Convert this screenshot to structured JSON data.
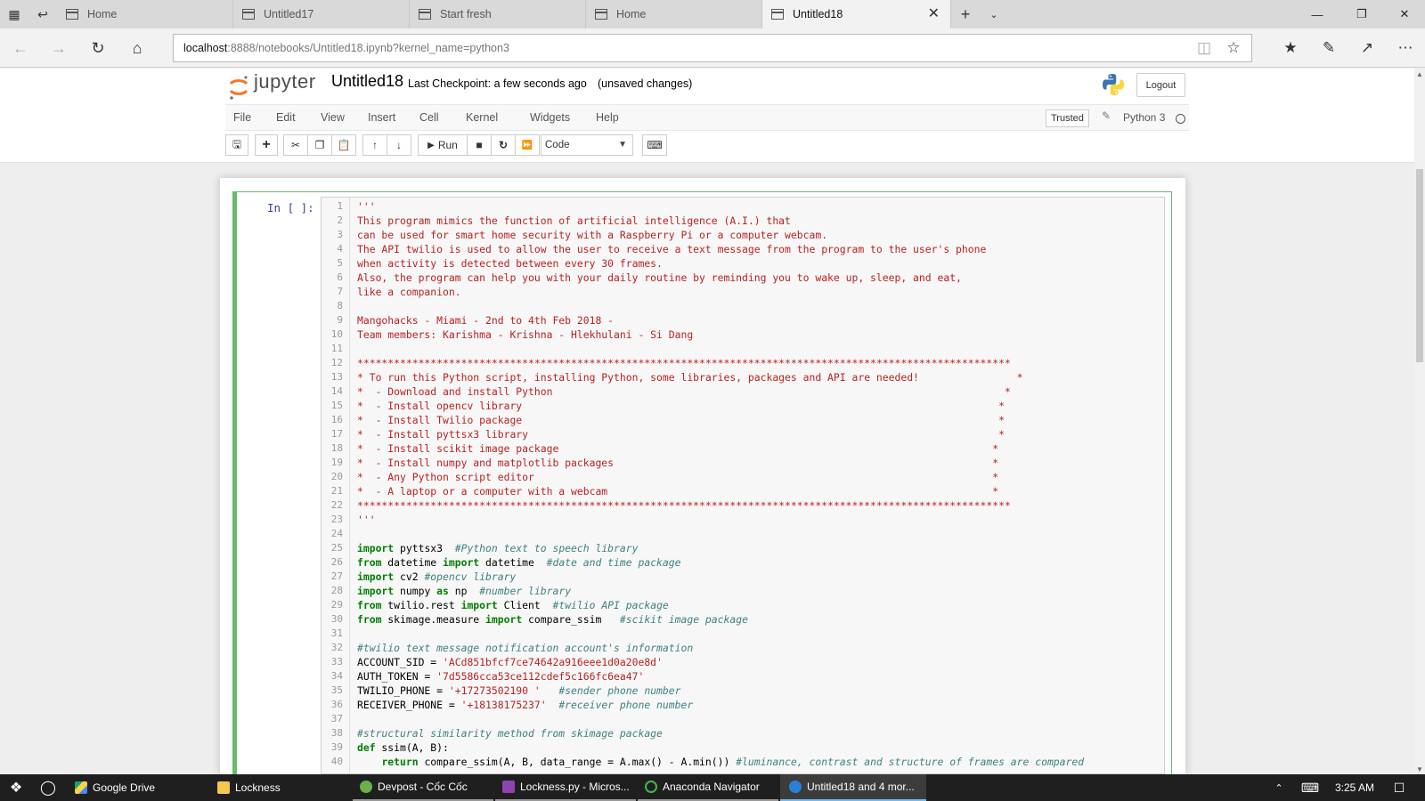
{
  "browser": {
    "tabs": [
      {
        "label": "Home"
      },
      {
        "label": "Untitled17"
      },
      {
        "label": "Start fresh"
      },
      {
        "label": "Home"
      },
      {
        "label": "Untitled18"
      }
    ],
    "url_host": "localhost",
    "url_rest": ":8888/notebooks/Untitled18.ipynb?kernel_name=python3"
  },
  "jupyter": {
    "logo_text": "jupyter",
    "notebook_name": "Untitled18",
    "checkpoint": "Last Checkpoint: a few seconds ago",
    "unsaved": "(unsaved changes)",
    "logout_label": "Logout",
    "menu": [
      "File",
      "Edit",
      "View",
      "Insert",
      "Cell",
      "Kernel",
      "Widgets",
      "Help"
    ],
    "trusted_label": "Trusted",
    "kernel_label": "Python 3",
    "run_label": "Run",
    "cell_type": "Code",
    "prompt": "In [ ]:"
  },
  "code_lines": [
    [
      [
        "s",
        "'''"
      ]
    ],
    [
      [
        "s",
        "This program mimics the function of artificial intelligence (A.I.) that"
      ]
    ],
    [
      [
        "s",
        "can be used for smart home security with a Raspberry Pi or a computer webcam."
      ]
    ],
    [
      [
        "s",
        "The API twilio is used to allow the user to receive a text message from the program to the user's phone"
      ]
    ],
    [
      [
        "s",
        "when activity is detected between every 30 frames."
      ]
    ],
    [
      [
        "s",
        "Also, the program can help you with your daily routine by reminding you to wake up, sleep, and eat,"
      ]
    ],
    [
      [
        "s",
        "like a companion."
      ]
    ],
    [],
    [
      [
        "s",
        "Mangohacks - Miami - 2nd to 4th Feb 2018 -"
      ]
    ],
    [
      [
        "s",
        "Team members: Karishma - Krishna - Hlekhulani - Si Dang"
      ]
    ],
    [],
    [
      [
        "s",
        "***********************************************************************************************************"
      ]
    ],
    [
      [
        "s",
        "* To run this Python script, installing Python, some libraries, packages and API are needed!                *"
      ]
    ],
    [
      [
        "s",
        "*  - Download and install Python                                                                          *"
      ]
    ],
    [
      [
        "s",
        "*  - Install opencv library                                                                              *"
      ]
    ],
    [
      [
        "s",
        "*  - Install Twilio package                                                                              *"
      ]
    ],
    [
      [
        "s",
        "*  - Install pyttsx3 library                                                                             *"
      ]
    ],
    [
      [
        "s",
        "*  - Install scikit image package                                                                       *"
      ]
    ],
    [
      [
        "s",
        "*  - Install numpy and matplotlib packages                                                              *"
      ]
    ],
    [
      [
        "s",
        "*  - Any Python script editor                                                                           *"
      ]
    ],
    [
      [
        "s",
        "*  - A laptop or a computer with a webcam                                                               *"
      ]
    ],
    [
      [
        "s",
        "***********************************************************************************************************"
      ]
    ],
    [
      [
        "s",
        "'''"
      ]
    ],
    [],
    [
      [
        "k",
        "import"
      ],
      [
        "t",
        " pyttsx3  "
      ],
      [
        "c",
        "#Python text to speech library"
      ]
    ],
    [
      [
        "k",
        "from"
      ],
      [
        "t",
        " datetime "
      ],
      [
        "k",
        "import"
      ],
      [
        "t",
        " datetime  "
      ],
      [
        "c",
        "#date and time package"
      ]
    ],
    [
      [
        "k",
        "import"
      ],
      [
        "t",
        " cv2 "
      ],
      [
        "c",
        "#opencv library"
      ]
    ],
    [
      [
        "k",
        "import"
      ],
      [
        "t",
        " numpy "
      ],
      [
        "k",
        "as"
      ],
      [
        "t",
        " np  "
      ],
      [
        "c",
        "#number library"
      ]
    ],
    [
      [
        "k",
        "from"
      ],
      [
        "t",
        " twilio.rest "
      ],
      [
        "k",
        "import"
      ],
      [
        "t",
        " Client  "
      ],
      [
        "c",
        "#twilio API package"
      ]
    ],
    [
      [
        "k",
        "from"
      ],
      [
        "t",
        " skimage.measure "
      ],
      [
        "k",
        "import"
      ],
      [
        "t",
        " compare_ssim   "
      ],
      [
        "c",
        "#scikit image package"
      ]
    ],
    [],
    [
      [
        "c",
        "#twilio text message notification account's information"
      ]
    ],
    [
      [
        "t",
        "ACCOUNT_SID = "
      ],
      [
        "s",
        "'ACd851bfcf7ce74642a916eee1d0a20e8d'"
      ]
    ],
    [
      [
        "t",
        "AUTH_TOKEN = "
      ],
      [
        "s",
        "'7d5586cca53ce112cdef5c166fc6ea47'"
      ]
    ],
    [
      [
        "t",
        "TWILIO_PHONE = "
      ],
      [
        "s",
        "'+17273502190 '"
      ],
      [
        "t",
        "   "
      ],
      [
        "c",
        "#sender phone number"
      ]
    ],
    [
      [
        "t",
        "RECEIVER_PHONE = "
      ],
      [
        "s",
        "'+18138175237'"
      ],
      [
        "t",
        "  "
      ],
      [
        "c",
        "#receiver phone number"
      ]
    ],
    [],
    [
      [
        "c",
        "#structural similarity method from skimage package"
      ]
    ],
    [
      [
        "k",
        "def"
      ],
      [
        "t",
        " ssim(A, B):"
      ]
    ],
    [
      [
        "t",
        "    "
      ],
      [
        "k",
        "return"
      ],
      [
        "t",
        " compare_ssim(A, B, data_range = A.max() - A.min()) "
      ],
      [
        "c",
        "#luminance, contrast and structure of frames are compared"
      ]
    ]
  ],
  "taskbar": {
    "items": [
      {
        "label": "Google Drive"
      },
      {
        "label": "Lockness"
      },
      {
        "label": "Devpost - Cốc Cốc"
      },
      {
        "label": "Lockness.py - Micros..."
      },
      {
        "label": "Anaconda Navigator"
      },
      {
        "label": "Untitled18 and 4 mor..."
      }
    ],
    "clock": "3:25 AM"
  },
  "colors": {
    "accent_green": "#66bb6a",
    "code_string": "#ba2121",
    "code_keyword": "#008000",
    "code_comment": "#408080",
    "taskbar_bg": "#1f1f1f"
  }
}
